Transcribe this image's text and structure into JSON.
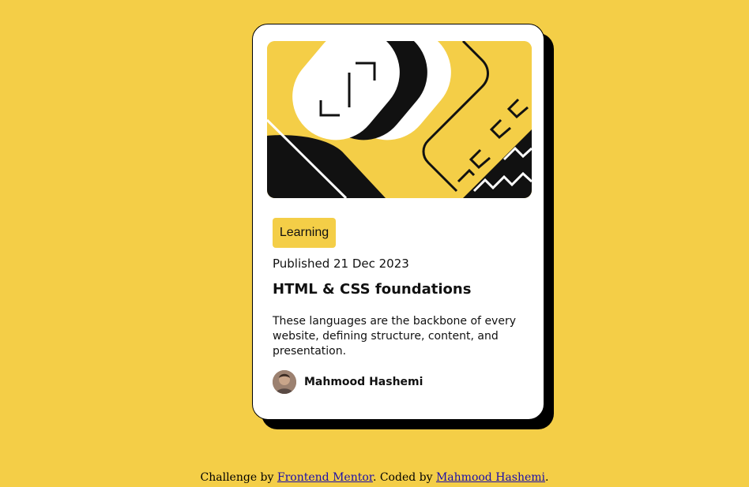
{
  "colors": {
    "background": "#F4CE47",
    "card": "#FFFFFF",
    "ink": "#111111",
    "link": "#1A0DAB"
  },
  "card": {
    "hero_image": "illustration-article",
    "tag": "Learning",
    "published": "Published 21 Dec 2023",
    "title": "HTML & CSS foundations",
    "description": "These languages are the backbone of every website, defining structure, content, and presentation.",
    "author": {
      "avatar": "author-avatar",
      "name": "Mahmood Hashemi"
    }
  },
  "footer": {
    "prefix": "Challenge by ",
    "link1": "Frontend Mentor",
    "middle": ". Coded by ",
    "link2": "Mahmood Hashemi",
    "suffix": "."
  }
}
